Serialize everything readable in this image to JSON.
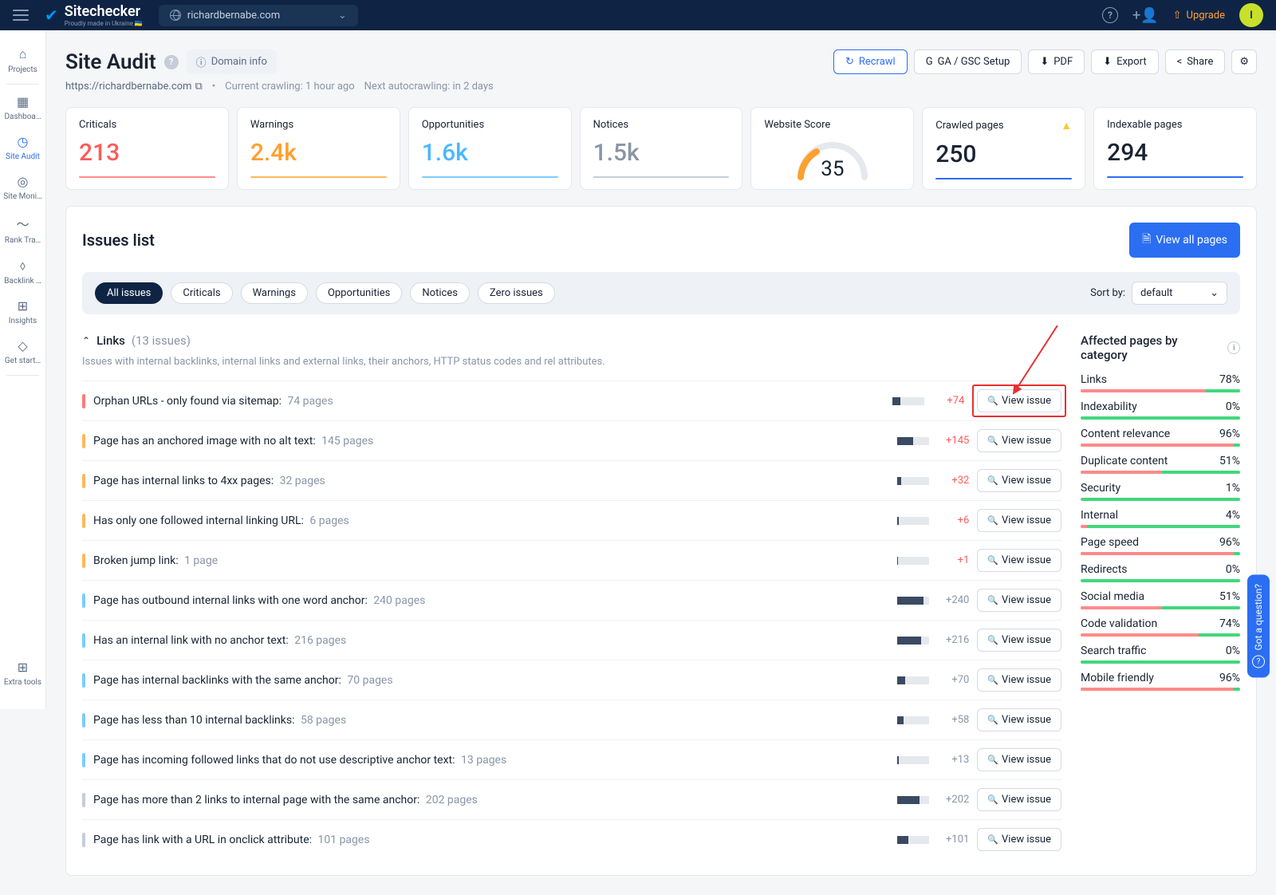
{
  "topbar": {
    "brand": "Sitechecker",
    "tagline": "Proudly made in Ukraine 🇺🇦",
    "domain": "richardbernabe.com",
    "upgrade": "Upgrade",
    "avatar_initial": "I"
  },
  "sidebar": {
    "items": [
      {
        "icon": "⌂",
        "label": "Projects"
      },
      {
        "icon": "▦",
        "label": "Dashboa…"
      },
      {
        "icon": "◷",
        "label": "Site Audit",
        "active": true
      },
      {
        "icon": "◎",
        "label": "Site Moni…"
      },
      {
        "icon": "〜",
        "label": "Rank Tra…"
      },
      {
        "icon": "⬨",
        "label": "Backlink …"
      },
      {
        "icon": "⊞",
        "label": "Insights"
      },
      {
        "icon": "◇",
        "label": "Get start…"
      }
    ],
    "bottom": {
      "icon": "⊞",
      "label": "Extra tools"
    }
  },
  "header": {
    "title": "Site Audit",
    "domain_info": "Domain info",
    "url": "https://richardbernabe.com",
    "crawl_current": "Current crawling: 1 hour ago",
    "crawl_next": "Next autocrawling: in 2 days",
    "actions": {
      "recrawl": "Recrawl",
      "ga_gsc": "GA / GSC Setup",
      "pdf": "PDF",
      "export": "Export",
      "share": "Share"
    }
  },
  "stats": [
    {
      "label": "Criticals",
      "value": "213",
      "color": "red"
    },
    {
      "label": "Warnings",
      "value": "2.4k",
      "color": "orange"
    },
    {
      "label": "Opportunities",
      "value": "1.6k",
      "color": "blue"
    },
    {
      "label": "Notices",
      "value": "1.5k",
      "color": "grey"
    },
    {
      "label": "Website Score",
      "value": "35",
      "type": "gauge"
    },
    {
      "label": "Crawled pages",
      "value": "250",
      "color": "dark",
      "warn": true
    },
    {
      "label": "Indexable pages",
      "value": "294",
      "color": "dark"
    }
  ],
  "issues": {
    "title": "Issues list",
    "view_all": "View all pages",
    "filters": [
      "All issues",
      "Criticals",
      "Warnings",
      "Opportunities",
      "Notices",
      "Zero issues"
    ],
    "sort_label": "Sort by:",
    "sort_value": "default",
    "section": {
      "name": "Links",
      "count": "(13 issues)",
      "desc": "Issues with internal backlinks, internal links and external links, their anchors, HTTP status codes and rel attributes."
    },
    "view_issue": "View issue",
    "rows": [
      {
        "sev": "critical",
        "title": "Orphan URLs - only found via sitemap:",
        "pages": "74 pages",
        "fill": 25,
        "delta": "+74",
        "pos": true,
        "highlight": true
      },
      {
        "sev": "warning",
        "title": "Page has an anchored image with no alt text:",
        "pages": "145 pages",
        "fill": 50,
        "delta": "+145",
        "pos": true
      },
      {
        "sev": "warning",
        "title": "Page has internal links to 4xx pages:",
        "pages": "32 pages",
        "fill": 12,
        "delta": "+32",
        "pos": true
      },
      {
        "sev": "warning",
        "title": "Has only one followed internal linking URL:",
        "pages": "6 pages",
        "fill": 3,
        "delta": "+6",
        "pos": true
      },
      {
        "sev": "warning",
        "title": "Broken jump link:",
        "pages": "1 page",
        "fill": 1,
        "delta": "+1",
        "pos": true
      },
      {
        "sev": "opportunity",
        "title": "Page has outbound internal links with one word anchor:",
        "pages": "240 pages",
        "fill": 82,
        "delta": "+240"
      },
      {
        "sev": "opportunity",
        "title": "Has an internal link with no anchor text:",
        "pages": "216 pages",
        "fill": 74,
        "delta": "+216"
      },
      {
        "sev": "opportunity",
        "title": "Page has internal backlinks with the same anchor:",
        "pages": "70 pages",
        "fill": 24,
        "delta": "+70"
      },
      {
        "sev": "opportunity",
        "title": "Page has less than 10 internal backlinks:",
        "pages": "58 pages",
        "fill": 20,
        "delta": "+58"
      },
      {
        "sev": "opportunity",
        "title": "Page has incoming followed links that do not use descriptive anchor text:",
        "pages": "13 pages",
        "fill": 5,
        "delta": "+13"
      },
      {
        "sev": "notice",
        "title": "Page has more than 2 links to internal page with the same anchor:",
        "pages": "202 pages",
        "fill": 69,
        "delta": "+202"
      },
      {
        "sev": "notice",
        "title": "Page has link with a URL in onclick attribute:",
        "pages": "101 pages",
        "fill": 35,
        "delta": "+101"
      }
    ],
    "categories": {
      "title": "Affected pages by category",
      "items": [
        {
          "name": "Links",
          "pct": "78%",
          "fill": 78
        },
        {
          "name": "Indexability",
          "pct": "0%",
          "fill": 0
        },
        {
          "name": "Content relevance",
          "pct": "96%",
          "fill": 96
        },
        {
          "name": "Duplicate content",
          "pct": "51%",
          "fill": 51
        },
        {
          "name": "Security",
          "pct": "1%",
          "fill": 1
        },
        {
          "name": "Internal",
          "pct": "4%",
          "fill": 4
        },
        {
          "name": "Page speed",
          "pct": "96%",
          "fill": 96
        },
        {
          "name": "Redirects",
          "pct": "0%",
          "fill": 0
        },
        {
          "name": "Social media",
          "pct": "51%",
          "fill": 51
        },
        {
          "name": "Code validation",
          "pct": "74%",
          "fill": 74
        },
        {
          "name": "Search traffic",
          "pct": "0%",
          "fill": 0
        },
        {
          "name": "Mobile friendly",
          "pct": "96%",
          "fill": 96
        }
      ]
    }
  },
  "help_widget": "Got a question?"
}
